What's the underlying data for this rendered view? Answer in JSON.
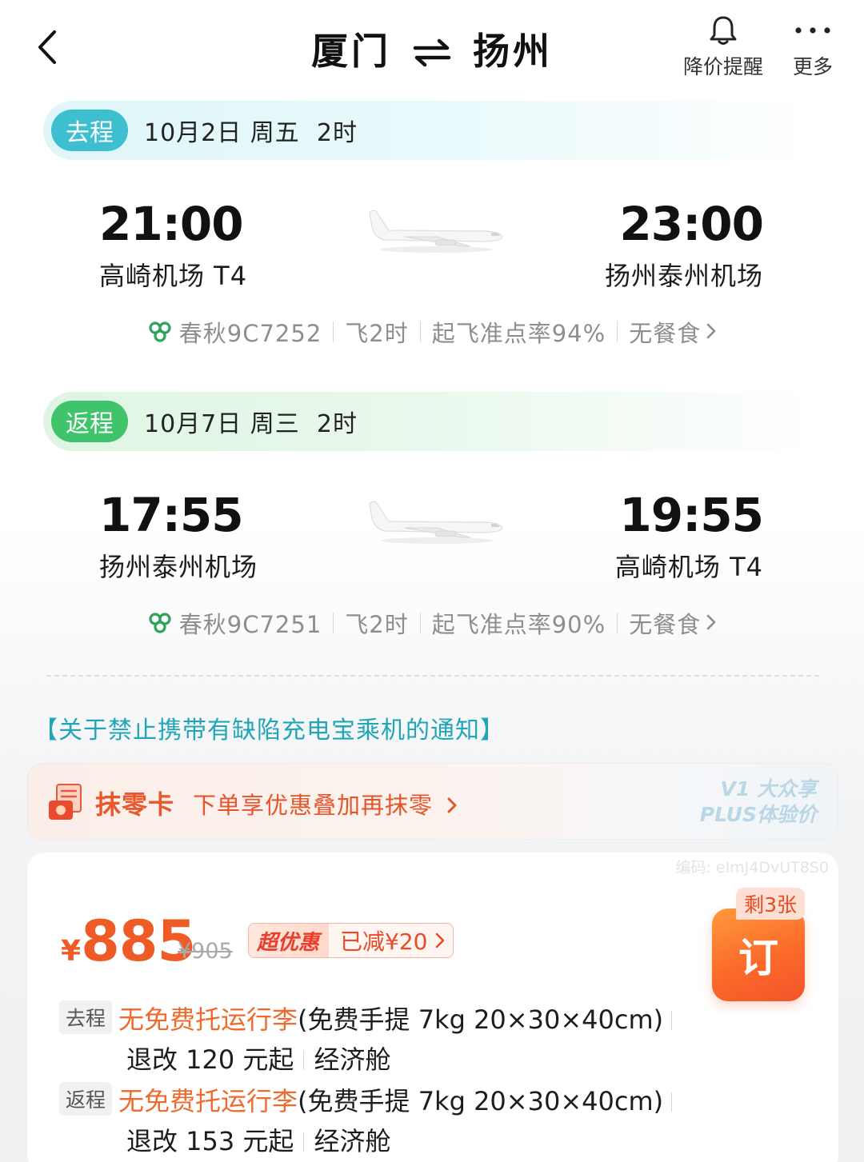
{
  "header": {
    "from_city": "厦门",
    "to_city": "扬州",
    "price_alert_label": "降价提醒",
    "more_label": "更多"
  },
  "outbound": {
    "tag": "去程",
    "date": "10月2日 周五  2时",
    "dep_time": "21:00",
    "dep_airport": "高崎机场 T4",
    "arr_time": "23:00",
    "arr_airport": "扬州泰州机场",
    "flight_no": "春秋9C7252",
    "duration": "飞2时",
    "on_time": "起飞准点率94%",
    "meal": "无餐食"
  },
  "return": {
    "tag": "返程",
    "date": "10月7日 周三  2时",
    "dep_time": "17:55",
    "dep_airport": "扬州泰州机场",
    "arr_time": "19:55",
    "arr_airport": "高崎机场 T4",
    "flight_no": "春秋9C7251",
    "duration": "飞2时",
    "on_time": "起飞准点率90%",
    "meal": "无餐食"
  },
  "notice": "【关于禁止携带有缺陷充电宝乘机的通知】",
  "promo": {
    "title": "抹零卡",
    "desc": "下单享优惠叠加再抹零",
    "badge_line1": "V1 大众享",
    "badge_line2": "PLUS体验价"
  },
  "fare": {
    "code": "编码: eImJ4DvUT8S0",
    "currency": "¥",
    "price": "885",
    "original_price": "¥905",
    "deal_label": "超优惠",
    "deal_amount": "已减¥20",
    "remaining": "剩3张",
    "book_label": "订",
    "out_tag": "去程",
    "out_baggage_warn": "无免费托运行李",
    "out_baggage_detail": "(免费手提 7kg 20×30×40cm)",
    "out_refund": "退改 120 元起",
    "out_cabin": "经济舱",
    "ret_tag": "返程",
    "ret_baggage_warn": "无免费托运行李",
    "ret_baggage_detail": "(免费手提 7kg 20×30×40cm)",
    "ret_refund": "退改 153 元起",
    "ret_cabin": "经济舱"
  },
  "colors": {
    "accent_orange": "#ef5b27",
    "outbound_teal": "#3dbfd0",
    "return_green": "#3fc46b",
    "notice_teal": "#20a6b6"
  }
}
